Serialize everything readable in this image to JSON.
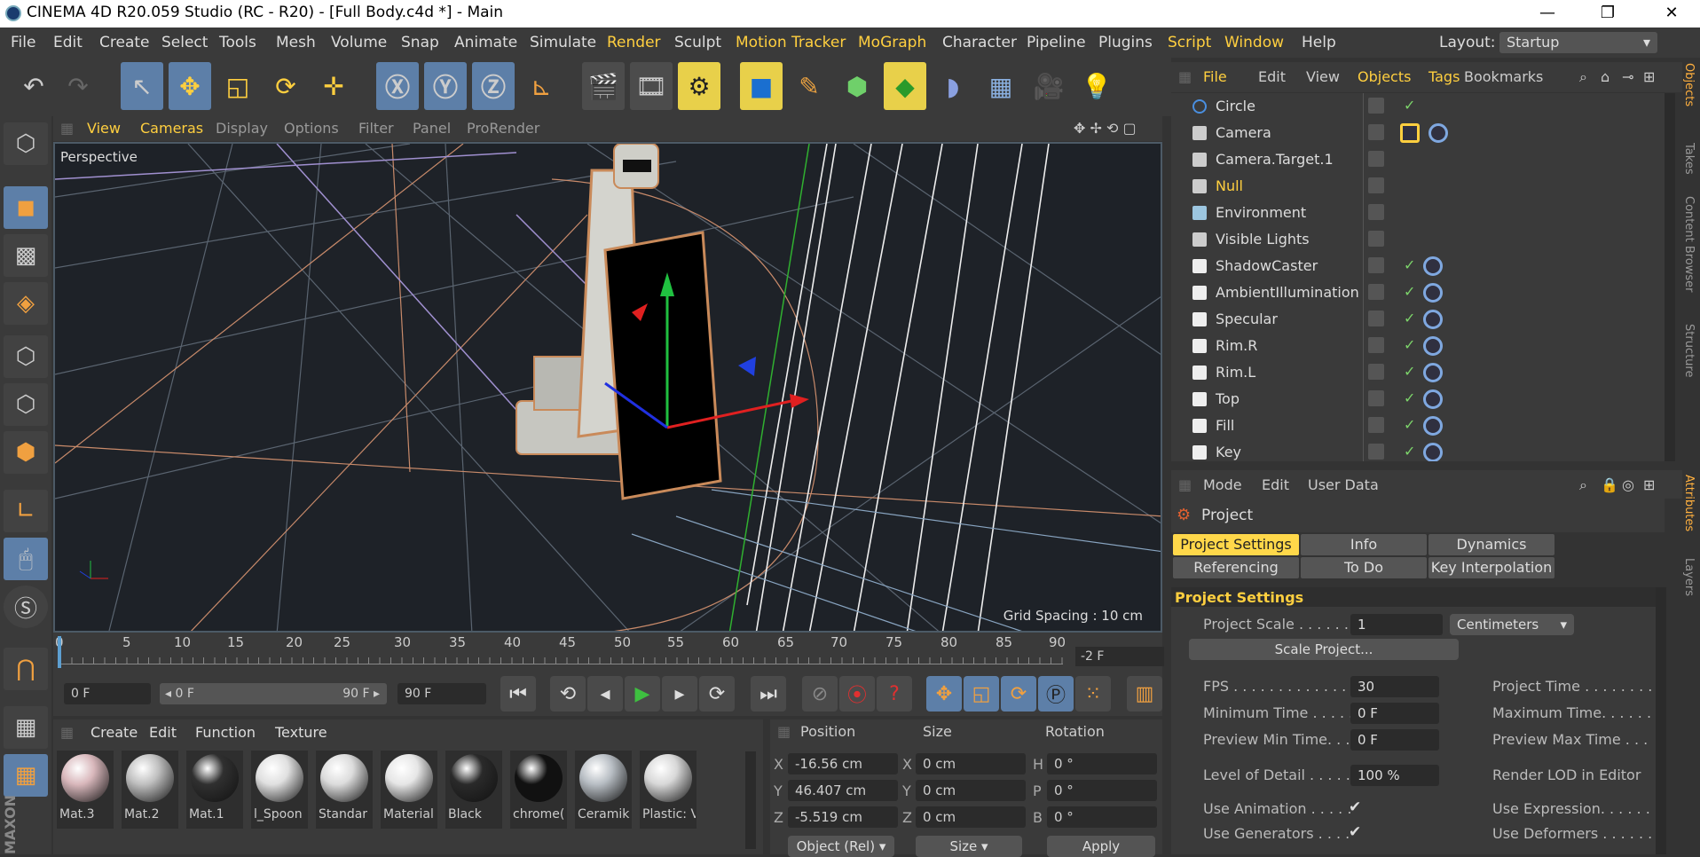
{
  "window": {
    "title": "CINEMA 4D R20.059 Studio (RC - R20) - [Full Body.c4d *] - Main",
    "minimize": "—",
    "restore": "❐",
    "close": "✕"
  },
  "menubar": {
    "items": [
      "File",
      "Edit",
      "Create",
      "Select",
      "Tools",
      "Mesh",
      "Volume",
      "Snap",
      "Animate",
      "Simulate",
      "Render",
      "Sculpt",
      "Motion Tracker",
      "MoGraph",
      "Character",
      "Pipeline",
      "Plugins",
      "Script",
      "Window",
      "Help"
    ],
    "layout_label": "Layout:",
    "layout_value": "Startup"
  },
  "toolbar": {
    "icons": [
      "undo-icon",
      "redo-icon",
      "select-icon",
      "move-icon",
      "scale-icon",
      "rotate-icon",
      "transform-icon",
      "x-axis-icon",
      "y-axis-icon",
      "z-axis-icon",
      "coordinate-system-icon",
      "render-view-icon",
      "render-picture-queue-icon",
      "render-settings-icon",
      "cube-icon",
      "pen-icon",
      "subdivision-icon",
      "cloner-icon",
      "deformer-icon",
      "floor-icon",
      "camera-icon",
      "light-icon"
    ]
  },
  "viewport": {
    "menus": [
      "View",
      "Cameras",
      "Display",
      "Options",
      "Filter",
      "Panel",
      "ProRender"
    ],
    "label": "Perspective",
    "grid_spacing": "Grid Spacing : 10 cm"
  },
  "timeline": {
    "ticks": [
      "0",
      "5",
      "10",
      "15",
      "20",
      "25",
      "30",
      "35",
      "40",
      "45",
      "50",
      "55",
      "60",
      "65",
      "70",
      "75",
      "80",
      "85",
      "90"
    ],
    "current_frame": "-2 F"
  },
  "transport": {
    "start": "0 F",
    "range_start": "◂ 0 F",
    "range_end": "90 F ▸",
    "end": "90 F"
  },
  "materials": {
    "menus": [
      "Create",
      "Edit",
      "Function",
      "Texture"
    ],
    "items": [
      {
        "name": "Mat.3",
        "color": "#d9b8bc"
      },
      {
        "name": "Mat.2",
        "color": "#c0c0c0"
      },
      {
        "name": "Mat.1",
        "color": "#303030"
      },
      {
        "name": "l_Spoon",
        "color": "#e0e0e0"
      },
      {
        "name": "Standar",
        "color": "#dcdcdc"
      },
      {
        "name": "Material",
        "color": "#e6e6e6"
      },
      {
        "name": "Black",
        "color": "#2a2a2a"
      },
      {
        "name": "chrome(",
        "color": "#111111"
      },
      {
        "name": "Ceramik",
        "color": "#b8bec4"
      },
      {
        "name": "Plastic: V",
        "color": "#d8d8d8"
      }
    ]
  },
  "coords": {
    "headers": [
      "Position",
      "Size",
      "Rotation"
    ],
    "labels_pos": [
      "X",
      "Y",
      "Z"
    ],
    "labels_size": [
      "X",
      "Y",
      "Z"
    ],
    "labels_rot": [
      "H",
      "P",
      "B"
    ],
    "position": [
      "-16.56 cm",
      "46.407 cm",
      "-5.519 cm"
    ],
    "size": [
      "0 cm",
      "0 cm",
      "0 cm"
    ],
    "rotation": [
      "0 °",
      "0 °",
      "0 °"
    ],
    "mode": "Object (Rel) ▾",
    "size_mode": "Size ▾",
    "apply": "Apply"
  },
  "objects": {
    "menus": [
      "File",
      "Edit",
      "View",
      "Objects",
      "Tags",
      "Bookmarks"
    ],
    "rows": [
      {
        "name": "Circle",
        "icon": "#4a8fe0"
      },
      {
        "name": "Camera",
        "icon": "#cccccc"
      },
      {
        "name": "Camera.Target.1",
        "icon": "#cccccc"
      },
      {
        "name": "Null",
        "icon": "#cccccc"
      },
      {
        "name": "Environment",
        "icon": "#9cc6e0"
      },
      {
        "name": "Visible Lights",
        "icon": "#cccccc"
      },
      {
        "name": "ShadowCaster",
        "icon": "#eeeeee"
      },
      {
        "name": "AmbientIllumination",
        "icon": "#eeeeee"
      },
      {
        "name": "Specular",
        "icon": "#eeeeee"
      },
      {
        "name": "Rim.R",
        "icon": "#eeeeee"
      },
      {
        "name": "Rim.L",
        "icon": "#eeeeee"
      },
      {
        "name": "Top",
        "icon": "#eeeeee"
      },
      {
        "name": "Fill",
        "icon": "#eeeeee"
      },
      {
        "name": "Key",
        "icon": "#eeeeee"
      }
    ]
  },
  "side_tabs": [
    "Objects",
    "Takes",
    "Content Browser",
    "Structure"
  ],
  "side_tabs_bottom": [
    "Attributes",
    "Layers"
  ],
  "attributes": {
    "menus": [
      "Mode",
      "Edit",
      "User Data"
    ],
    "title": "Project",
    "tabs": [
      "Project Settings",
      "Info",
      "Dynamics",
      "Referencing",
      "To Do",
      "Key Interpolation"
    ],
    "section": "Project Settings",
    "project_scale_label": "Project Scale . . . . . . .",
    "project_scale_value": "1",
    "project_scale_unit": "Centimeters",
    "scale_project_button": "Scale Project...",
    "fps_label": "FPS . . . . . . . . . . . . . . .",
    "fps_value": "30",
    "min_time_label": "Minimum Time . . . . .",
    "min_time_value": "0 F",
    "preview_min_label": "Preview Min Time. . .",
    "preview_min_value": "0 F",
    "lod_label": "Level of Detail . . . . .",
    "lod_value": "100 %",
    "project_time_label": "Project Time . . . . . . . .",
    "max_time_label": "Maximum Time. . . . . . .",
    "preview_max_label": "Preview Max Time . . .",
    "render_lod_label": "Render LOD in Editor",
    "use_animation_label": "Use Animation . . . . .",
    "use_generators_label": "Use Generators . . . .",
    "use_expression_label": "Use Expression. . . . . . .",
    "use_deformers_label": "Use Deformers . . . . . . .",
    "check": "✔"
  }
}
